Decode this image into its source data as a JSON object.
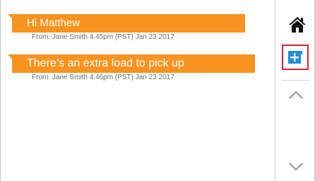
{
  "messages": [
    {
      "text": "Hi Matthew",
      "meta": "From: Jane Smith  4:45pm (PST) Jan 23 2017"
    },
    {
      "text": "There’s an extra load to pick up",
      "meta": "From: Jane Smith  4:46pm (PST) Jan 23 2017"
    }
  ],
  "sidebar": {
    "icons": [
      "home-icon",
      "add-message-icon",
      "chevron-up-icon",
      "chevron-down-icon"
    ]
  },
  "colors": {
    "bubble": "#f7931e",
    "add_icon": "#1f8fd6",
    "highlight_border": "#d8242b"
  }
}
